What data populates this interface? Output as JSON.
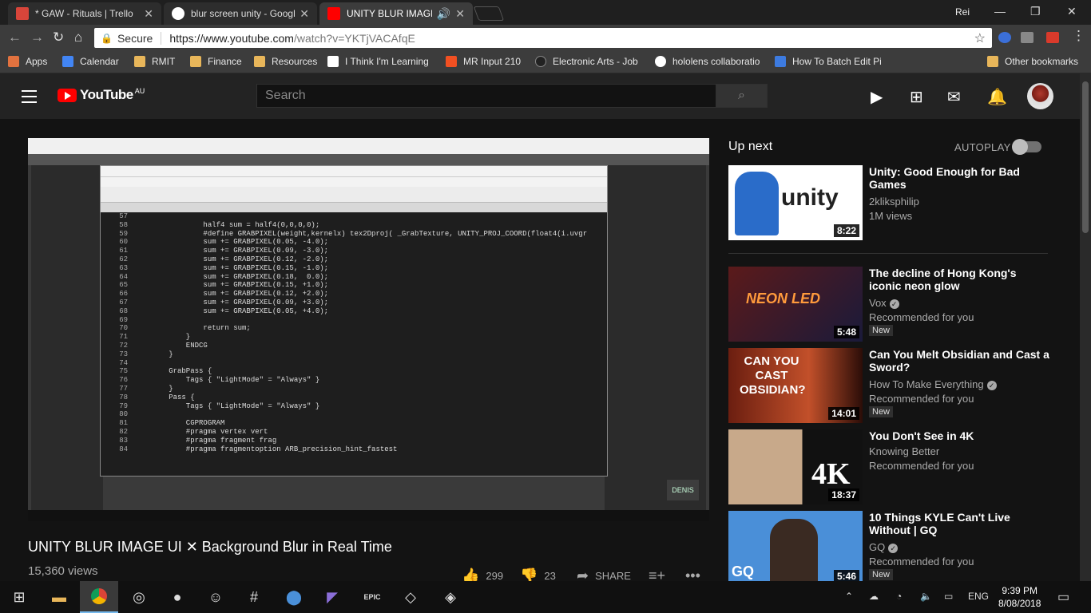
{
  "browser": {
    "tabs": [
      {
        "title": "* GAW - Rituals | Trello",
        "favicon": "trello-icon",
        "color": "#d8453a"
      },
      {
        "title": "blur screen unity - Googl",
        "favicon": "google-icon",
        "color": "#ffffff"
      },
      {
        "title": "UNITY BLUR IMAGE U",
        "favicon": "youtube-icon",
        "color": "#ff0000"
      }
    ],
    "profile": "Rei",
    "omnibox": {
      "secure_label": "Secure",
      "url_host": "https://www.youtube.com",
      "url_path": "/watch?v=YKTjVACAfqE"
    },
    "bookmarks": [
      {
        "label": "Apps",
        "icon": "apps-grid-icon",
        "color": "#e2723f"
      },
      {
        "label": "Calendar",
        "icon": "calendar-icon",
        "color": "#4285f4"
      },
      {
        "label": "RMIT",
        "icon": "folder-icon",
        "color": "#e8b65a"
      },
      {
        "label": "Finance",
        "icon": "folder-icon",
        "color": "#e8b65a"
      },
      {
        "label": "Resources",
        "icon": "folder-icon",
        "color": "#e8b65a"
      },
      {
        "label": "I Think I'm Learning",
        "icon": "site-icon",
        "color": "#ffffff"
      },
      {
        "label": "MR Input 210",
        "icon": "microsoft-icon",
        "color": "#f25022"
      },
      {
        "label": "Electronic Arts - Job",
        "icon": "ea-icon",
        "color": "#222222"
      },
      {
        "label": "hololens collaboratio",
        "icon": "google-icon",
        "color": "#ffffff"
      },
      {
        "label": "How To Batch Edit Pi",
        "icon": "plus-icon",
        "color": "#3d7be0"
      },
      {
        "label": "Other bookmarks",
        "icon": "folder-icon",
        "color": "#e8b65a"
      }
    ]
  },
  "youtube": {
    "logo_text": "YouTube",
    "region": "AU",
    "search_placeholder": "Search",
    "video": {
      "title": "UNITY BLUR IMAGE UI ✕ Background Blur in Real Time",
      "views": "15,360 views",
      "likes": "299",
      "dislikes": "23",
      "share": "SHARE",
      "screen_badge": "DENIS"
    },
    "code_lines": [
      {
        "n": "57",
        "t": ""
      },
      {
        "n": "58",
        "t": "                half4 sum = half4(0,0,0,0);"
      },
      {
        "n": "59",
        "t": "                #define GRABPIXEL(weight,kernelx) tex2Dproj( _GrabTexture, UNITY_PROJ_COORD(float4(i.uvgr"
      },
      {
        "n": "60",
        "t": "                sum += GRABPIXEL(0.05, -4.0);"
      },
      {
        "n": "61",
        "t": "                sum += GRABPIXEL(0.09, -3.0);"
      },
      {
        "n": "62",
        "t": "                sum += GRABPIXEL(0.12, -2.0);"
      },
      {
        "n": "63",
        "t": "                sum += GRABPIXEL(0.15, -1.0);"
      },
      {
        "n": "64",
        "t": "                sum += GRABPIXEL(0.18,  0.0);"
      },
      {
        "n": "65",
        "t": "                sum += GRABPIXEL(0.15, +1.0);"
      },
      {
        "n": "66",
        "t": "                sum += GRABPIXEL(0.12, +2.0);"
      },
      {
        "n": "67",
        "t": "                sum += GRABPIXEL(0.09, +3.0);"
      },
      {
        "n": "68",
        "t": "                sum += GRABPIXEL(0.05, +4.0);"
      },
      {
        "n": "69",
        "t": ""
      },
      {
        "n": "70",
        "t": "                return sum;"
      },
      {
        "n": "71",
        "t": "            }"
      },
      {
        "n": "72",
        "t": "            ENDCG"
      },
      {
        "n": "73",
        "t": "        }"
      },
      {
        "n": "74",
        "t": ""
      },
      {
        "n": "75",
        "t": "        GrabPass {"
      },
      {
        "n": "76",
        "t": "            Tags { \"LightMode\" = \"Always\" }"
      },
      {
        "n": "77",
        "t": "        }"
      },
      {
        "n": "78",
        "t": "        Pass {"
      },
      {
        "n": "79",
        "t": "            Tags { \"LightMode\" = \"Always\" }"
      },
      {
        "n": "80",
        "t": ""
      },
      {
        "n": "81",
        "t": "            CGPROGRAM"
      },
      {
        "n": "82",
        "t": "            #pragma vertex vert"
      },
      {
        "n": "83",
        "t": "            #pragma fragment frag"
      },
      {
        "n": "84",
        "t": "            #pragma fragmentoption ARB_precision_hint_fastest"
      }
    ],
    "sidebar": {
      "up_next": "Up next",
      "autoplay": "AUTOPLAY",
      "videos": [
        {
          "title": "Unity: Good Enough for Bad Games",
          "channel": "2kliksphilip",
          "meta": "1M views",
          "duration": "8:22",
          "badge": "",
          "thumb_text": "unity"
        },
        {
          "title": "The decline of Hong Kong's iconic neon glow",
          "channel": "Vox",
          "meta": "Recommended for you",
          "duration": "5:48",
          "badge": "New",
          "thumb_text": "NEON LED"
        },
        {
          "title": "Can You Melt Obsidian and Cast a Sword?",
          "channel": "How To Make Everything",
          "meta": "Recommended for you",
          "duration": "14:01",
          "badge": "New",
          "thumb_text": "CAN YOU CAST OBSIDIAN?"
        },
        {
          "title": "You Don't See in 4K",
          "channel": "Knowing Better",
          "meta": "Recommended for you",
          "duration": "18:37",
          "badge": "",
          "thumb_text": "4K"
        },
        {
          "title": "10 Things KYLE Can't Live Without | GQ",
          "channel": "GQ",
          "meta": "Recommended for you",
          "duration": "5:46",
          "badge": "New",
          "thumb_text": "GQ"
        }
      ]
    }
  },
  "taskbar": {
    "language": "ENG",
    "time": "9:39 PM",
    "date": "8/08/2018"
  }
}
